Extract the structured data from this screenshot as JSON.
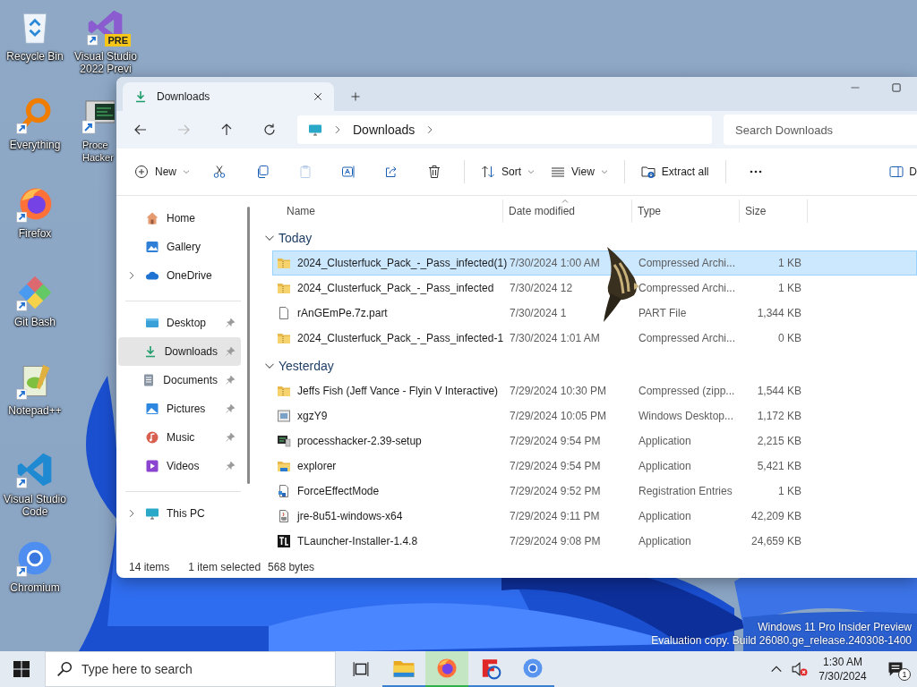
{
  "desktop_icons": [
    {
      "kind": "recycle-bin",
      "lines": [
        "Recycle Bin"
      ],
      "shortcut": false
    },
    {
      "kind": "everything",
      "lines": [
        "Everything"
      ],
      "shortcut": true
    },
    {
      "kind": "firefox",
      "lines": [
        "Firefox"
      ],
      "shortcut": true
    },
    {
      "kind": "git",
      "lines": [
        "Git Bash"
      ],
      "shortcut": true
    },
    {
      "kind": "notepad",
      "lines": [
        "Notepad++"
      ],
      "shortcut": true
    },
    {
      "kind": "vscode",
      "lines": [
        "Visual Studio",
        "Code"
      ],
      "shortcut": true
    },
    {
      "kind": "chromium",
      "lines": [
        "Chromium"
      ],
      "shortcut": true
    }
  ],
  "desktop_icons_column_2": [
    {
      "kind": "vs-preview",
      "lines": [
        "Visual Studio",
        "2022 Previ"
      ],
      "badge": "PRE",
      "shortcut": true
    },
    {
      "kind": "hacker",
      "lines": [
        "Proce",
        "Hacker"
      ],
      "shortcut": true
    }
  ],
  "explorer": {
    "tab": {
      "title": "Downloads"
    },
    "nav": [
      {
        "kind": "back",
        "disabled": false
      },
      {
        "kind": "forward",
        "disabled": true
      },
      {
        "kind": "up",
        "disabled": false
      },
      {
        "kind": "refresh",
        "disabled": false
      }
    ],
    "breadcrumb": [
      "Downloads"
    ],
    "search": {
      "placeholder": "Search Downloads"
    },
    "toolbar": [
      [
        {
          "kind": "new",
          "label": "New",
          "dropdown": true,
          "disabled": false
        },
        {
          "kind": "cut",
          "disabled": false
        },
        {
          "kind": "copy",
          "disabled": false
        },
        {
          "kind": "paste",
          "disabled": true
        },
        {
          "kind": "rename",
          "disabled": false
        },
        {
          "kind": "share",
          "disabled": false
        },
        {
          "kind": "delete",
          "disabled": false
        }
      ],
      [
        {
          "kind": "sort",
          "label": "Sort",
          "dropdown": true,
          "disabled": false
        },
        {
          "kind": "view",
          "label": "View",
          "dropdown": true,
          "disabled": false
        }
      ],
      [
        {
          "kind": "extract",
          "label": "Extract all",
          "dropdown": false,
          "disabled": false
        }
      ],
      [
        {
          "kind": "more",
          "disabled": false
        }
      ]
    ],
    "details": {
      "label": "D"
    },
    "sidebar": [
      [
        {
          "kind": "home",
          "label": "Home",
          "expandable": false,
          "pinned": false,
          "selected": false
        },
        {
          "kind": "gallery",
          "label": "Gallery",
          "expandable": false,
          "pinned": false,
          "selected": false
        },
        {
          "kind": "onedrive",
          "label": "OneDrive",
          "expandable": true,
          "pinned": false,
          "selected": false
        }
      ],
      [
        {
          "kind": "desktop",
          "label": "Desktop",
          "expandable": false,
          "pinned": true,
          "selected": false
        },
        {
          "kind": "downloads",
          "label": "Downloads",
          "expandable": false,
          "pinned": true,
          "selected": true
        },
        {
          "kind": "documents",
          "label": "Documents",
          "expandable": false,
          "pinned": true,
          "selected": false
        },
        {
          "kind": "pictures",
          "label": "Pictures",
          "expandable": false,
          "pinned": true,
          "selected": false
        },
        {
          "kind": "music",
          "label": "Music",
          "expandable": false,
          "pinned": true,
          "selected": false
        },
        {
          "kind": "videos",
          "label": "Videos",
          "expandable": false,
          "pinned": true,
          "selected": false
        }
      ],
      [
        {
          "kind": "thispc",
          "label": "This PC",
          "expandable": true,
          "pinned": false,
          "selected": false
        }
      ]
    ],
    "columns": [
      "Name",
      "Date modified",
      "Type",
      "Size"
    ],
    "file_groups": [
      {
        "label": "Today",
        "expanded": true,
        "rows": [
          {
            "kind": "zip",
            "name": "2024_Clusterfuck_Pack_-_Pass_infected(1)",
            "date": "7/30/2024 1:00 AM",
            "type": "Compressed Archi...",
            "size": "1 KB",
            "selected": true
          },
          {
            "kind": "zip",
            "name": "2024_Clusterfuck_Pack_-_Pass_infected",
            "date": "7/30/2024 12",
            "type": "Compressed Archi...",
            "size": "1 KB",
            "selected": false
          },
          {
            "kind": "blank",
            "name": "rAnGEmPe.7z.part",
            "date": "7/30/2024 1",
            "type": "PART File",
            "size": "1,344 KB",
            "selected": false
          },
          {
            "kind": "zip",
            "name": "2024_Clusterfuck_Pack_-_Pass_infected-1",
            "date": "7/30/2024 1:01 AM",
            "type": "Compressed Archi...",
            "size": "0 KB",
            "selected": false
          }
        ]
      },
      {
        "label": "Yesterday",
        "expanded": true,
        "rows": [
          {
            "kind": "zip",
            "name": "Jeffs Fish (Jeff Vance - Flyin V Interactive)",
            "date": "7/29/2024 10:30 PM",
            "type": "Compressed (zipp...",
            "size": "1,544 KB",
            "selected": false
          },
          {
            "kind": "rdp",
            "name": "xgzY9",
            "date": "7/29/2024 10:05 PM",
            "type": "Windows Desktop...",
            "size": "1,172 KB",
            "selected": false
          },
          {
            "kind": "ph",
            "name": "processhacker-2.39-setup",
            "date": "7/29/2024 9:54 PM",
            "type": "Application",
            "size": "2,215 KB",
            "selected": false
          },
          {
            "kind": "explorer",
            "name": "explorer",
            "date": "7/29/2024 9:54 PM",
            "type": "Application",
            "size": "5,421 KB",
            "selected": false
          },
          {
            "kind": "reg",
            "name": "ForceEffectMode",
            "date": "7/29/2024 9:52 PM",
            "type": "Registration Entries",
            "size": "1 KB",
            "selected": false
          },
          {
            "kind": "java",
            "name": "jre-8u51-windows-x64",
            "date": "7/29/2024 9:11 PM",
            "type": "Application",
            "size": "42,209 KB",
            "selected": false
          },
          {
            "kind": "tl",
            "name": "TLauncher-Installer-1.4.8",
            "date": "7/29/2024 9:08 PM",
            "type": "Application",
            "size": "24,659 KB",
            "selected": false
          }
        ]
      }
    ],
    "status_bar": {
      "count": "14 items",
      "selection": "1 item selected",
      "size": "568 bytes"
    }
  },
  "watermark": [
    "Windows 11 Pro Insider Preview",
    "Evaluation copy. Build 26080.ge_release.240308-1400"
  ],
  "taskbar": {
    "search": {
      "placeholder": "Type here to search"
    },
    "apps": [
      {
        "kind": "explorer",
        "selected": false
      },
      {
        "kind": "firefox",
        "selected": true
      },
      {
        "kind": "f-app",
        "selected": false
      },
      {
        "kind": "chromium",
        "selected": false
      }
    ],
    "time": "1:30 AM",
    "date": "7/30/2024",
    "notifications": "1"
  }
}
